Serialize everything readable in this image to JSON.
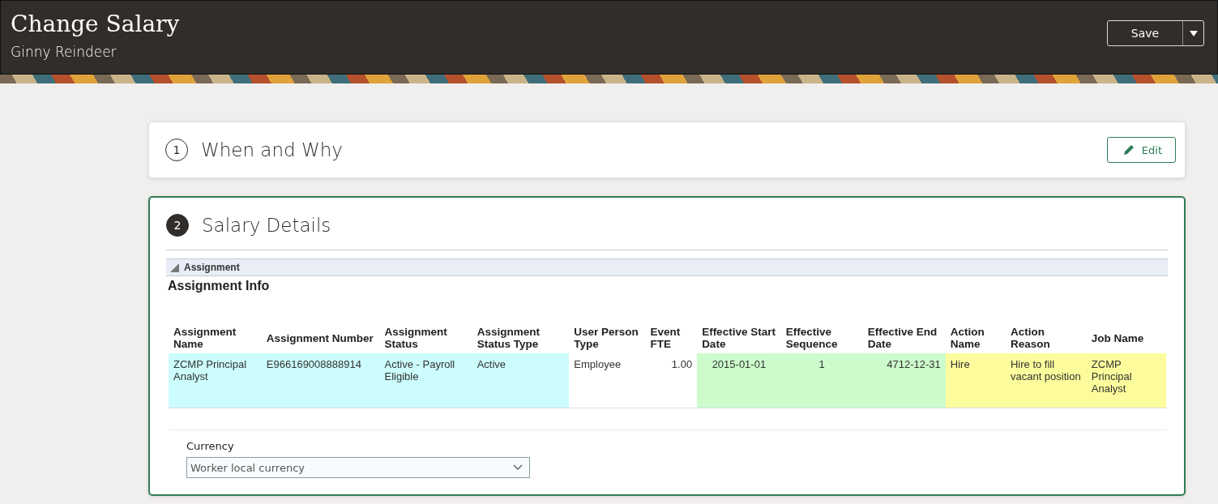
{
  "header": {
    "title": "Change Salary",
    "subtitle": "Ginny Reindeer",
    "save_button": "Save"
  },
  "steps": [
    {
      "number": "1",
      "title": "When and Why",
      "active": false,
      "action": "Edit"
    },
    {
      "number": "2",
      "title": "Salary Details",
      "active": true
    }
  ],
  "assignment": {
    "section_label": "Assignment",
    "expanded": true,
    "heading": "Assignment Info",
    "columns": [
      {
        "label": "Assignment Name",
        "kind": "text",
        "color": "#ccfcfc"
      },
      {
        "label": "Assignment Number",
        "kind": "text",
        "color": "#ccfcfc"
      },
      {
        "label": "Assignment Status",
        "kind": "text",
        "color": "#ccfcfc"
      },
      {
        "label": "Assignment Status Type",
        "kind": "text",
        "color": "#ccfcfc"
      },
      {
        "label": "User Person Type",
        "kind": "text",
        "color": "#ffffff"
      },
      {
        "label": "Event FTE",
        "kind": "number",
        "color": "#ffffff"
      },
      {
        "label": "Effective Start Date",
        "kind": "center",
        "color": "#ccfccc"
      },
      {
        "label": "Effective Sequence",
        "kind": "center",
        "color": "#ccfccc"
      },
      {
        "label": "Effective End Date",
        "kind": "number",
        "color": "#ccfccc"
      },
      {
        "label": "Action Name",
        "kind": "text",
        "color": "#fcfc9c"
      },
      {
        "label": "Action Reason",
        "kind": "text",
        "color": "#fcfc9c"
      },
      {
        "label": "Job Name",
        "kind": "text",
        "color": "#fcfc9c"
      }
    ],
    "rows": [
      [
        "ZCMP Principal Analyst",
        "E966169008888914",
        "Active - Payroll Eligible",
        "Active",
        "Employee",
        "1.00",
        "2015-01-01",
        "1",
        "4712-12-31",
        "Hire",
        "Hire to fill vacant position",
        "ZCMP Principal Analyst"
      ]
    ]
  },
  "currency": {
    "label": "Currency",
    "value": "Worker local currency"
  }
}
